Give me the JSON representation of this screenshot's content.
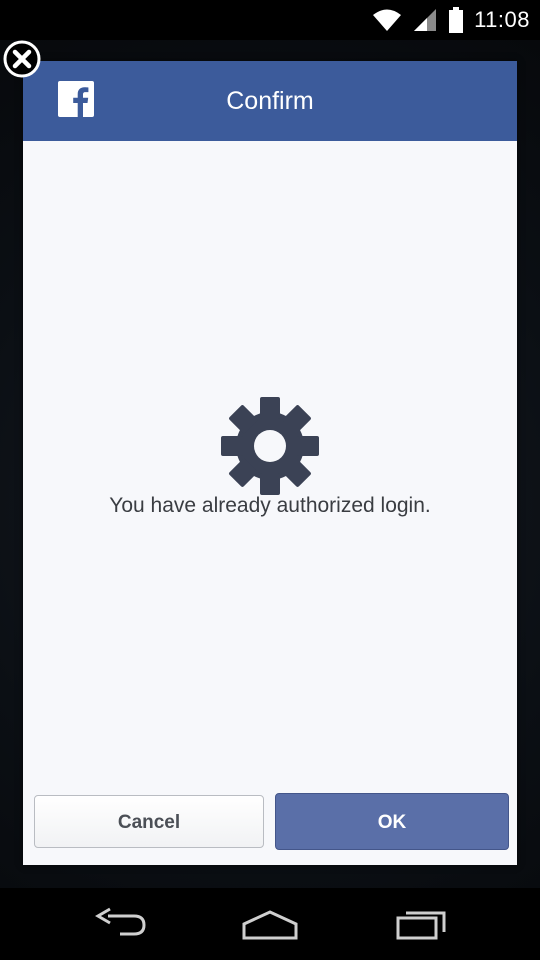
{
  "status_bar": {
    "time": "11:08",
    "wifi_icon": "wifi-icon",
    "signal_icon": "signal-icon",
    "battery_icon": "battery-icon"
  },
  "dialog": {
    "title": "Confirm",
    "logo_icon": "facebook-logo-icon",
    "close_icon": "close-icon",
    "status_icon": "gear-icon",
    "message": "You have already authorized login.",
    "cancel_label": "Cancel",
    "ok_label": "OK"
  },
  "nav_bar": {
    "back_icon": "back-icon",
    "home_icon": "home-icon",
    "recents_icon": "recents-icon"
  },
  "colors": {
    "header": "#3c5b9b",
    "ok_button": "#5a6fa8",
    "dialog_background": "#f7f8fb",
    "gear": "#3b4255"
  }
}
